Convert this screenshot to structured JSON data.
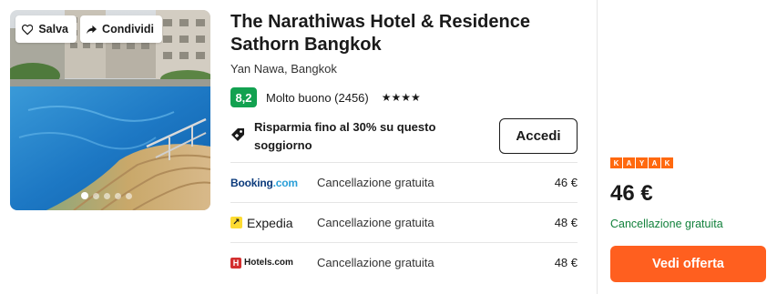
{
  "photo": {
    "save_label": "Salva",
    "share_label": "Condividi",
    "dot_count": 5,
    "active_dot": 0
  },
  "hotel": {
    "name": "The Narathiwas Hotel & Residence Sathorn Bangkok",
    "location": "Yan Nawa, Bangkok",
    "score": "8,2",
    "score_label": "Molto buono (2456)",
    "stars": "★★★★"
  },
  "promo": {
    "text": "Risparmia fino al 30% su questo soggiorno",
    "button_label": "Accedi"
  },
  "providers": [
    {
      "name_main": "Booking",
      "name_suffix": ".com",
      "cancellation": "Cancellazione gratuita",
      "price": "46 €"
    },
    {
      "name": "Expedia",
      "cancellation": "Cancellazione gratuita",
      "price": "48 €"
    },
    {
      "name": "Hotels.com",
      "cancellation": "Cancellazione gratuita",
      "price": "48 €"
    }
  ],
  "best_offer": {
    "brand_letters": [
      "K",
      "A",
      "Y",
      "A",
      "K"
    ],
    "price": "46 €",
    "cancellation": "Cancellazione gratuita",
    "button_label": "Vedi offerta"
  },
  "colors": {
    "score_green": "#12a150",
    "offer_orange": "#ff5f1f",
    "kayak_orange": "#ff690f",
    "free_cancel_green": "#12813c"
  }
}
